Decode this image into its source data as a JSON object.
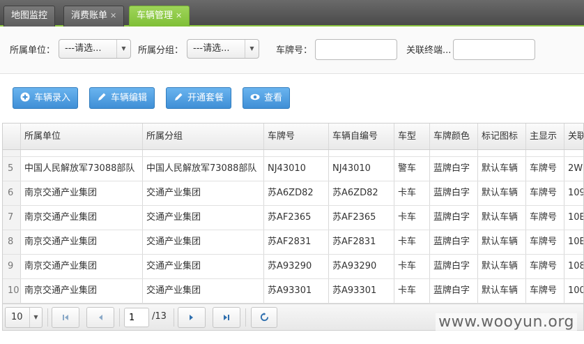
{
  "tabs": [
    {
      "label": "地图监控",
      "closable": false,
      "active": false
    },
    {
      "label": "消费账单",
      "closable": true,
      "active": false
    },
    {
      "label": "车辆管理",
      "closable": true,
      "active": true
    }
  ],
  "filters": {
    "unit_label": "所属单位：",
    "unit_value": "---请选...",
    "group_label": "所属分组：",
    "group_value": "---请选...",
    "plate_label": "车牌号：",
    "plate_value": "",
    "terminal_label": "关联终端...",
    "terminal_value": ""
  },
  "toolbar": {
    "add_label": "车辆录入",
    "edit_label": "车辆编辑",
    "plan_label": "开通套餐",
    "view_label": "查看"
  },
  "table": {
    "columns": [
      "所属单位",
      "所属分组",
      "车牌号",
      "车辆自编号",
      "车型",
      "车牌颜色",
      "标记图标",
      "主显示",
      "关联"
    ],
    "rows": [
      {
        "num": "5",
        "unit": "中国人民解放军73088部队",
        "group": "中国人民解放军73088部队",
        "plate": "NJ43010",
        "selfno": "NJ43010",
        "type": "警车",
        "color": "蓝牌白字",
        "icon": "默认车辆",
        "display": "车牌号",
        "link": "2W"
      },
      {
        "num": "6",
        "unit": "南京交通产业集团",
        "group": "交通产业集团",
        "plate": "苏A6ZD82",
        "selfno": "苏A6ZD82",
        "type": "卡车",
        "color": "蓝牌白字",
        "icon": "默认车辆",
        "display": "车牌号",
        "link": "109"
      },
      {
        "num": "7",
        "unit": "南京交通产业集团",
        "group": "交通产业集团",
        "plate": "苏AF2365",
        "selfno": "苏AF2365",
        "type": "卡车",
        "color": "蓝牌白字",
        "icon": "默认车辆",
        "display": "车牌号",
        "link": "10E"
      },
      {
        "num": "8",
        "unit": "南京交通产业集团",
        "group": "交通产业集团",
        "plate": "苏AF2831",
        "selfno": "苏AF2831",
        "type": "卡车",
        "color": "蓝牌白字",
        "icon": "默认车辆",
        "display": "车牌号",
        "link": "10E"
      },
      {
        "num": "9",
        "unit": "南京交通产业集团",
        "group": "交通产业集团",
        "plate": "苏A93290",
        "selfno": "苏A93290",
        "type": "卡车",
        "color": "蓝牌白字",
        "icon": "默认车辆",
        "display": "车牌号",
        "link": "108"
      },
      {
        "num": "10",
        "unit": "南京交通产业集团",
        "group": "交通产业集团",
        "plate": "苏A93301",
        "selfno": "苏A93301",
        "type": "卡车",
        "color": "蓝牌白字",
        "icon": "默认车辆",
        "display": "车牌号",
        "link": "100"
      }
    ]
  },
  "pager": {
    "page_size": "10",
    "page_input": "1",
    "total_pages": "/13"
  },
  "watermark": "www.wooyun.org",
  "colors": {
    "accent_green": "#8cc63f",
    "button_blue": "#3f8fd6"
  }
}
